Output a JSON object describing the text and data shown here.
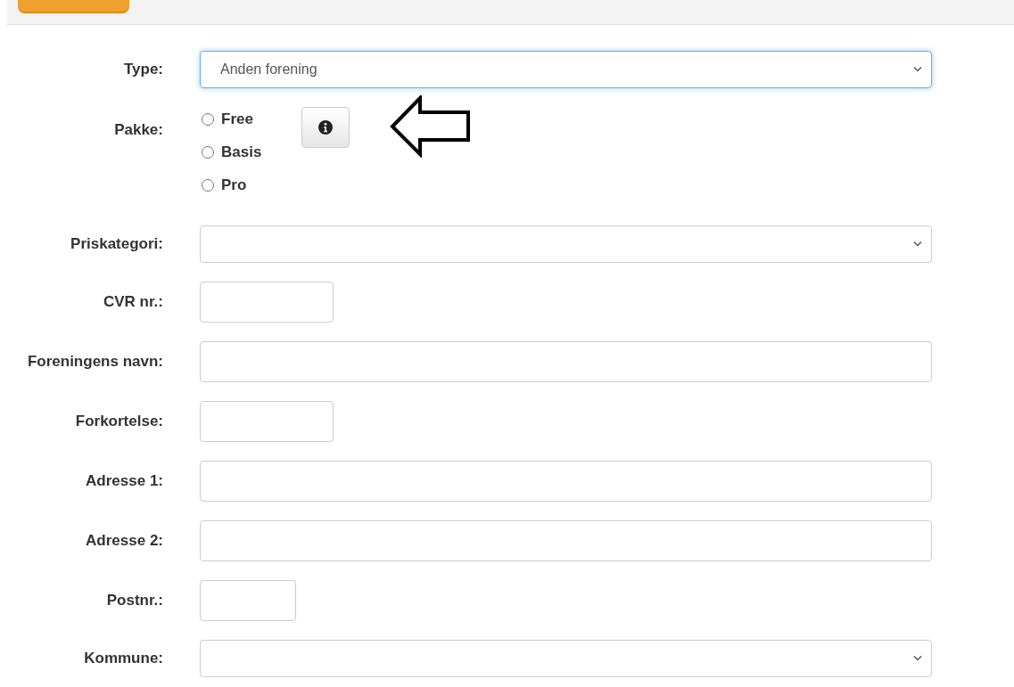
{
  "fields": [
    {
      "label": "Type:",
      "kind": "select",
      "value": "Anden forening",
      "focused": true
    },
    {
      "label": "Pakke:",
      "kind": "radio",
      "options": [
        {
          "label": "Free",
          "selected": false
        },
        {
          "label": "Basis",
          "selected": false
        },
        {
          "label": "Pro",
          "selected": false
        }
      ]
    },
    {
      "label": "Priskategori:",
      "kind": "select",
      "focused": false
    },
    {
      "label": "CVR nr.:",
      "kind": "text"
    },
    {
      "label": "Foreningens navn:",
      "kind": "text"
    },
    {
      "label": "Forkortelse:",
      "kind": "text"
    },
    {
      "label": "Adresse 1:",
      "kind": "text"
    },
    {
      "label": "Adresse 2:",
      "kind": "text"
    },
    {
      "label": "Postnr.:",
      "kind": "text"
    },
    {
      "label": "Kommune:",
      "kind": "select",
      "focused": false
    }
  ]
}
